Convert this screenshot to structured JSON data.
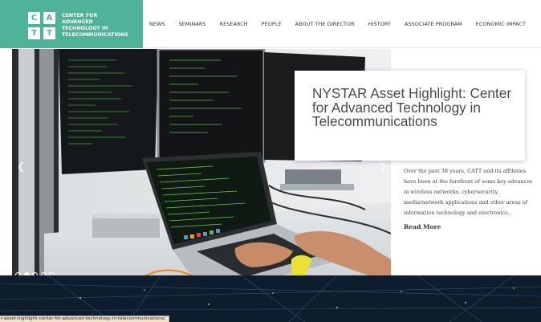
{
  "logo": {
    "letters": [
      "C",
      "A",
      "T",
      "T"
    ],
    "lines": [
      "CENTER FOR",
      "ADVANCED",
      "TECHNOLOGY IN",
      "TELECOMMUNICATIONS"
    ],
    "color": "#4fb39a"
  },
  "nav": {
    "items": [
      "NEWS",
      "SEMINARS",
      "RESEARCH",
      "PEOPLE",
      "ABOUT THE DIRECTOR",
      "HISTORY",
      "ASSOCIATE PROGRAM",
      "ECONOMIC IMPACT"
    ]
  },
  "slider": {
    "prev_icon": "chevron-left-icon",
    "next_icon": "chevron-right-icon",
    "dot_count": 5,
    "active_dot": 1
  },
  "highlight": {
    "title": "NYSTAR Asset Highlight: Center for Advanced Technology in Telecommunications",
    "excerpt": "Over the past 38 years, CATT and its affiliates have been at the forefront of some key advances in wireless networks, cybersecurity, media/network applications and other areas of information technology and electronics.",
    "read_more": "Read More"
  },
  "status_bar": {
    "url": "r-asset-highlight-center-for-advanced-technology-in-telecommunications/"
  }
}
